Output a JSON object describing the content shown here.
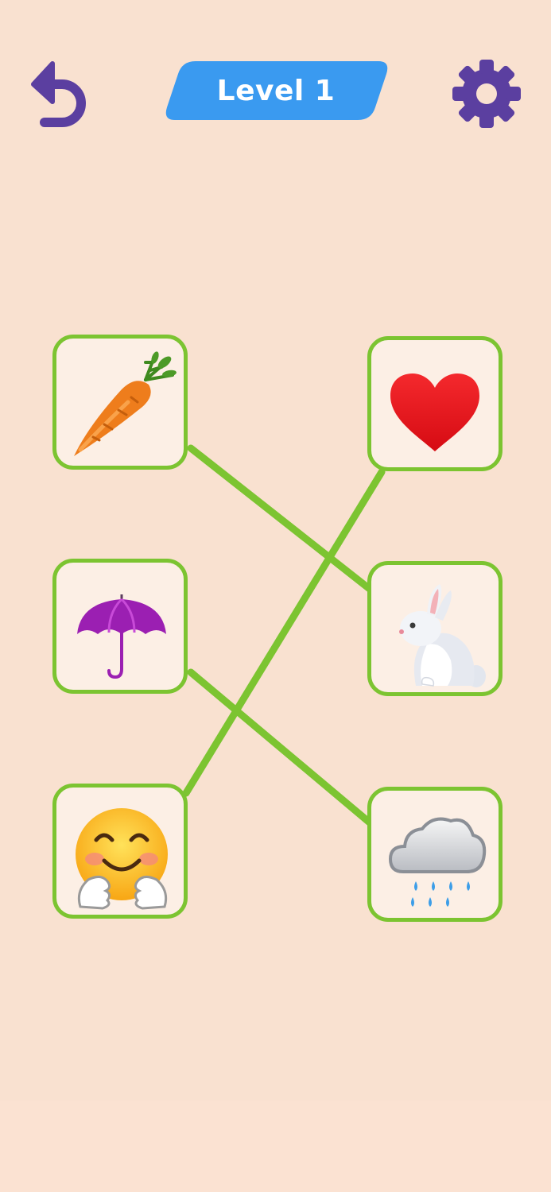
{
  "header": {
    "level_label": "Level 1",
    "undo_icon": "undo-arrow-icon",
    "settings_icon": "gear-icon"
  },
  "colors": {
    "background": "#f9e1d0",
    "card_fill": "#fcefe5",
    "card_border": "#7cc431",
    "line": "#7cc431",
    "badge": "#3a9af0",
    "icon": "#5b3fa0"
  },
  "board": {
    "left_column": [
      {
        "item": "carrot",
        "icon": "carrot-icon"
      },
      {
        "item": "umbrella",
        "icon": "umbrella-icon"
      },
      {
        "item": "smiling face with open hands",
        "icon": "hugging-face-icon"
      }
    ],
    "right_column": [
      {
        "item": "heart",
        "icon": "heart-icon"
      },
      {
        "item": "rabbit",
        "icon": "rabbit-icon"
      },
      {
        "item": "cloud with rain",
        "icon": "rain-cloud-icon"
      }
    ],
    "connections": [
      {
        "from": "carrot",
        "to": "rabbit"
      },
      {
        "from": "umbrella",
        "to": "cloud with rain"
      },
      {
        "from": "smiling face with open hands",
        "to": "heart"
      }
    ]
  }
}
